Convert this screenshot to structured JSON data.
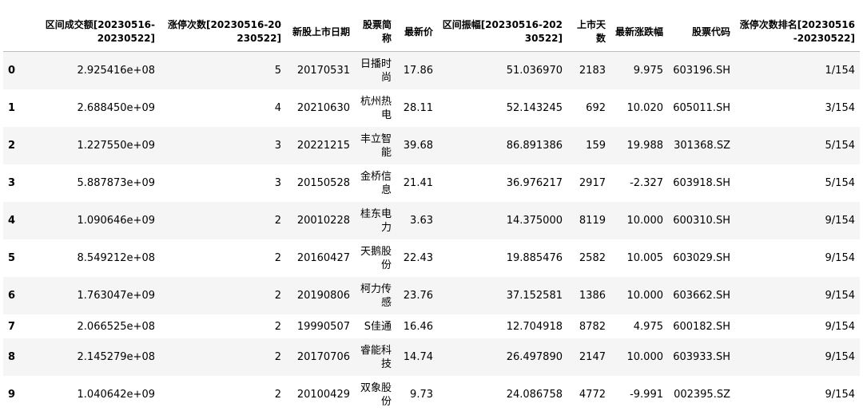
{
  "columns": [
    "",
    "区间成交额[20230516-20230522]",
    "涨停次数[20230516-20230522]",
    "新股上市日期",
    "股票简称",
    "最新价",
    "区间振幅[20230516-20230522]",
    "上市天数",
    "最新涨跌幅",
    "股票代码",
    "涨停次数排名[20230516-20230522]"
  ],
  "rows": [
    {
      "index": "0",
      "turnover": "2.925416e+08",
      "limit_up": "5",
      "list_date": "20170531",
      "name": "日播时尚",
      "price": "17.86",
      "amplitude": "51.036970",
      "days": "2183",
      "change": "9.975",
      "code": "603196.SH",
      "rank": "1/154"
    },
    {
      "index": "1",
      "turnover": "2.688450e+09",
      "limit_up": "4",
      "list_date": "20210630",
      "name": "杭州热电",
      "price": "28.11",
      "amplitude": "52.143245",
      "days": "692",
      "change": "10.020",
      "code": "605011.SH",
      "rank": "3/154"
    },
    {
      "index": "2",
      "turnover": "1.227550e+09",
      "limit_up": "3",
      "list_date": "20221215",
      "name": "丰立智能",
      "price": "39.68",
      "amplitude": "86.891386",
      "days": "159",
      "change": "19.988",
      "code": "301368.SZ",
      "rank": "5/154"
    },
    {
      "index": "3",
      "turnover": "5.887873e+09",
      "limit_up": "3",
      "list_date": "20150528",
      "name": "金桥信息",
      "price": "21.41",
      "amplitude": "36.976217",
      "days": "2917",
      "change": "-2.327",
      "code": "603918.SH",
      "rank": "5/154"
    },
    {
      "index": "4",
      "turnover": "1.090646e+09",
      "limit_up": "2",
      "list_date": "20010228",
      "name": "桂东电力",
      "price": "3.63",
      "amplitude": "14.375000",
      "days": "8119",
      "change": "10.000",
      "code": "600310.SH",
      "rank": "9/154"
    },
    {
      "index": "5",
      "turnover": "8.549212e+08",
      "limit_up": "2",
      "list_date": "20160427",
      "name": "天鹅股份",
      "price": "22.43",
      "amplitude": "19.885476",
      "days": "2582",
      "change": "10.005",
      "code": "603029.SH",
      "rank": "9/154"
    },
    {
      "index": "6",
      "turnover": "1.763047e+09",
      "limit_up": "2",
      "list_date": "20190806",
      "name": "柯力传感",
      "price": "23.76",
      "amplitude": "37.152581",
      "days": "1386",
      "change": "10.000",
      "code": "603662.SH",
      "rank": "9/154"
    },
    {
      "index": "7",
      "turnover": "2.066525e+08",
      "limit_up": "2",
      "list_date": "19990507",
      "name": "S佳通",
      "price": "16.46",
      "amplitude": "12.704918",
      "days": "8782",
      "change": "4.975",
      "code": "600182.SH",
      "rank": "9/154"
    },
    {
      "index": "8",
      "turnover": "2.145279e+08",
      "limit_up": "2",
      "list_date": "20170706",
      "name": "睿能科技",
      "price": "14.74",
      "amplitude": "26.497890",
      "days": "2147",
      "change": "10.000",
      "code": "603933.SH",
      "rank": "9/154"
    },
    {
      "index": "9",
      "turnover": "1.040642e+09",
      "limit_up": "2",
      "list_date": "20100429",
      "name": "双象股份",
      "price": "9.73",
      "amplitude": "24.086758",
      "days": "4772",
      "change": "-9.991",
      "code": "002395.SZ",
      "rank": "9/154"
    }
  ]
}
